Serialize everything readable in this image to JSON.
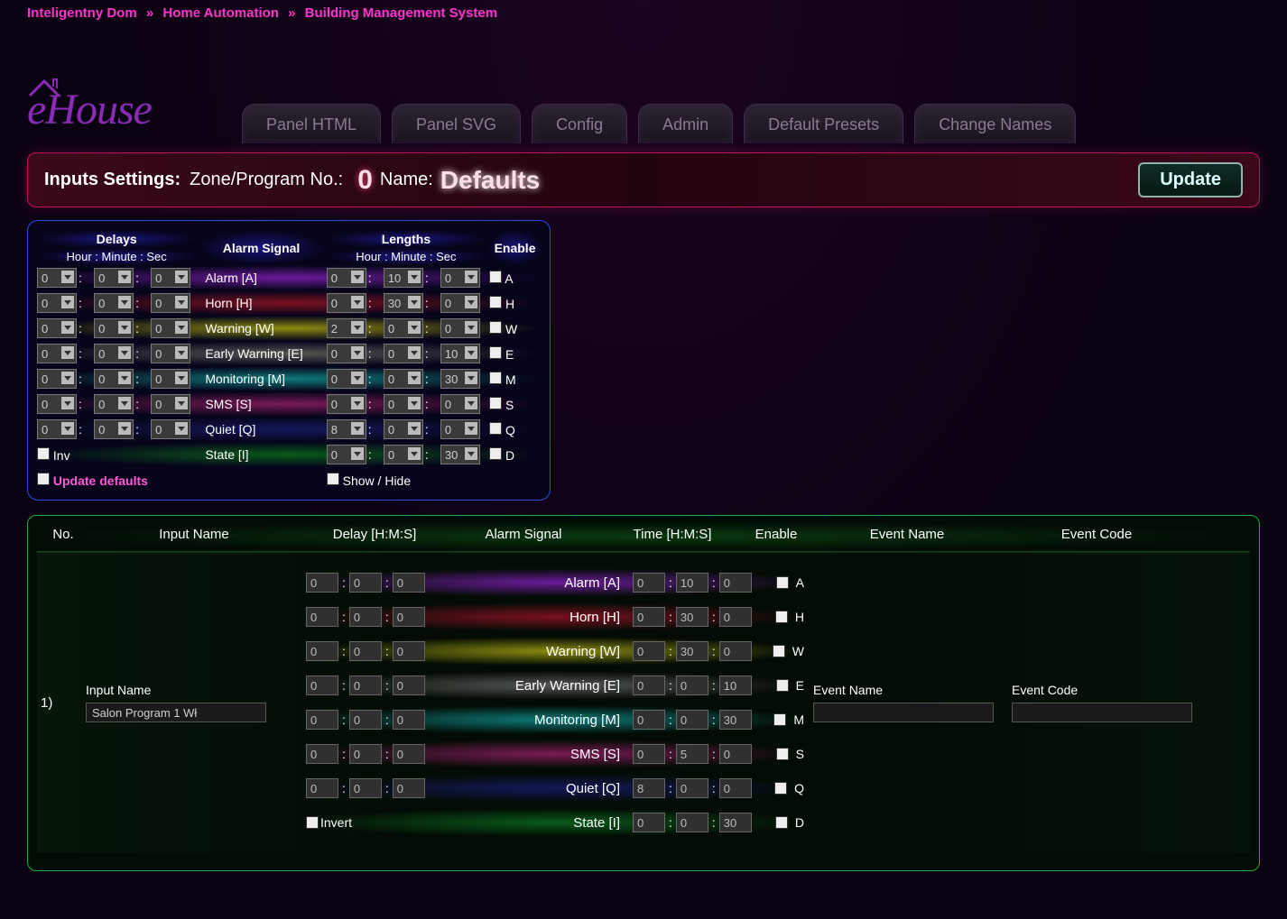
{
  "breadcrumbs": {
    "a": "Inteligentny Dom",
    "b": "Home Automation",
    "c": "Building Management System"
  },
  "logo": "eHouse",
  "tabs": [
    "Panel HTML",
    "Panel SVG",
    "Config",
    "Admin",
    "Default Presets",
    "Change Names"
  ],
  "titlebar": {
    "label": "Inputs Settings:",
    "zone_label": "Zone/Program No.:",
    "zone_value": "0",
    "name_label": "Name:",
    "name_value": "Defaults",
    "update": "Update"
  },
  "topbox": {
    "head_delays": "Delays",
    "head_lengths": "Lengths",
    "head_alarm_signal": "Alarm Signal",
    "head_enable": "Enable",
    "head_hms": "Hour : Minute : Sec",
    "signals": [
      {
        "name": "Alarm [A]",
        "en": "A",
        "grad": "grad-alarm",
        "d": [
          "0",
          "0",
          "0"
        ],
        "l": [
          "0",
          "10",
          "0"
        ]
      },
      {
        "name": "Horn [H]",
        "en": "H",
        "grad": "grad-horn",
        "d": [
          "0",
          "0",
          "0"
        ],
        "l": [
          "0",
          "30",
          "0"
        ]
      },
      {
        "name": "Warning [W]",
        "en": "W",
        "grad": "grad-warning",
        "d": [
          "0",
          "0",
          "0"
        ],
        "l": [
          "2",
          "0",
          "0"
        ]
      },
      {
        "name": "Early Warning [E]",
        "en": "E",
        "grad": "grad-early",
        "d": [
          "0",
          "0",
          "0"
        ],
        "l": [
          "0",
          "0",
          "10"
        ]
      },
      {
        "name": "Monitoring [M]",
        "en": "M",
        "grad": "grad-monitoring",
        "d": [
          "0",
          "0",
          "0"
        ],
        "l": [
          "0",
          "0",
          "30"
        ]
      },
      {
        "name": "SMS [S]",
        "en": "S",
        "grad": "grad-sms",
        "d": [
          "0",
          "0",
          "0"
        ],
        "l": [
          "0",
          "0",
          "0"
        ]
      },
      {
        "name": "Quiet [Q]",
        "en": "Q",
        "grad": "grad-quiet",
        "d": [
          "0",
          "0",
          "0"
        ],
        "l": [
          "8",
          "0",
          "0"
        ]
      },
      {
        "name": "State [I]",
        "en": "D",
        "grad": "grad-state",
        "d": null,
        "l": [
          "0",
          "0",
          "30"
        ]
      }
    ],
    "inv": "Inv",
    "update_defaults": "Update defaults",
    "show_hide": "Show / Hide"
  },
  "grid": {
    "head": {
      "no": "No.",
      "input_name": "Input Name",
      "delay": "Delay [H:M:S]",
      "alarm_signal": "Alarm Signal",
      "time": "Time [H:M:S]",
      "enable": "Enable",
      "event_name": "Event Name",
      "event_code": "Event Code"
    },
    "row1": {
      "no": "1)",
      "input_label": "Input Name",
      "input_value": "Salon Program 1 Wł",
      "event_label": "Event Name",
      "event_value": "",
      "code_label": "Event Code",
      "code_value": "",
      "invert_label": "Invert",
      "signals": [
        {
          "name": "Alarm [A]",
          "en": "A",
          "grad": "grad-alarm",
          "d": [
            "0",
            "0",
            "0"
          ],
          "t": [
            "0",
            "10",
            "0"
          ]
        },
        {
          "name": "Horn [H]",
          "en": "H",
          "grad": "grad-horn",
          "d": [
            "0",
            "0",
            "0"
          ],
          "t": [
            "0",
            "30",
            "0"
          ]
        },
        {
          "name": "Warning [W]",
          "en": "W",
          "grad": "grad-warning",
          "d": [
            "0",
            "0",
            "0"
          ],
          "t": [
            "0",
            "30",
            "0"
          ]
        },
        {
          "name": "Early Warning [E]",
          "en": "E",
          "grad": "grad-early",
          "d": [
            "0",
            "0",
            "0"
          ],
          "t": [
            "0",
            "0",
            "10"
          ]
        },
        {
          "name": "Monitoring [M]",
          "en": "M",
          "grad": "grad-monitoring",
          "d": [
            "0",
            "0",
            "0"
          ],
          "t": [
            "0",
            "0",
            "30"
          ]
        },
        {
          "name": "SMS [S]",
          "en": "S",
          "grad": "grad-sms",
          "d": [
            "0",
            "0",
            "0"
          ],
          "t": [
            "0",
            "5",
            "0"
          ]
        },
        {
          "name": "Quiet [Q]",
          "en": "Q",
          "grad": "grad-quiet",
          "d": [
            "0",
            "0",
            "0"
          ],
          "t": [
            "8",
            "0",
            "0"
          ]
        },
        {
          "name": "State [I]",
          "en": "D",
          "grad": "grad-state",
          "d": null,
          "t": [
            "0",
            "0",
            "30"
          ]
        }
      ]
    }
  }
}
